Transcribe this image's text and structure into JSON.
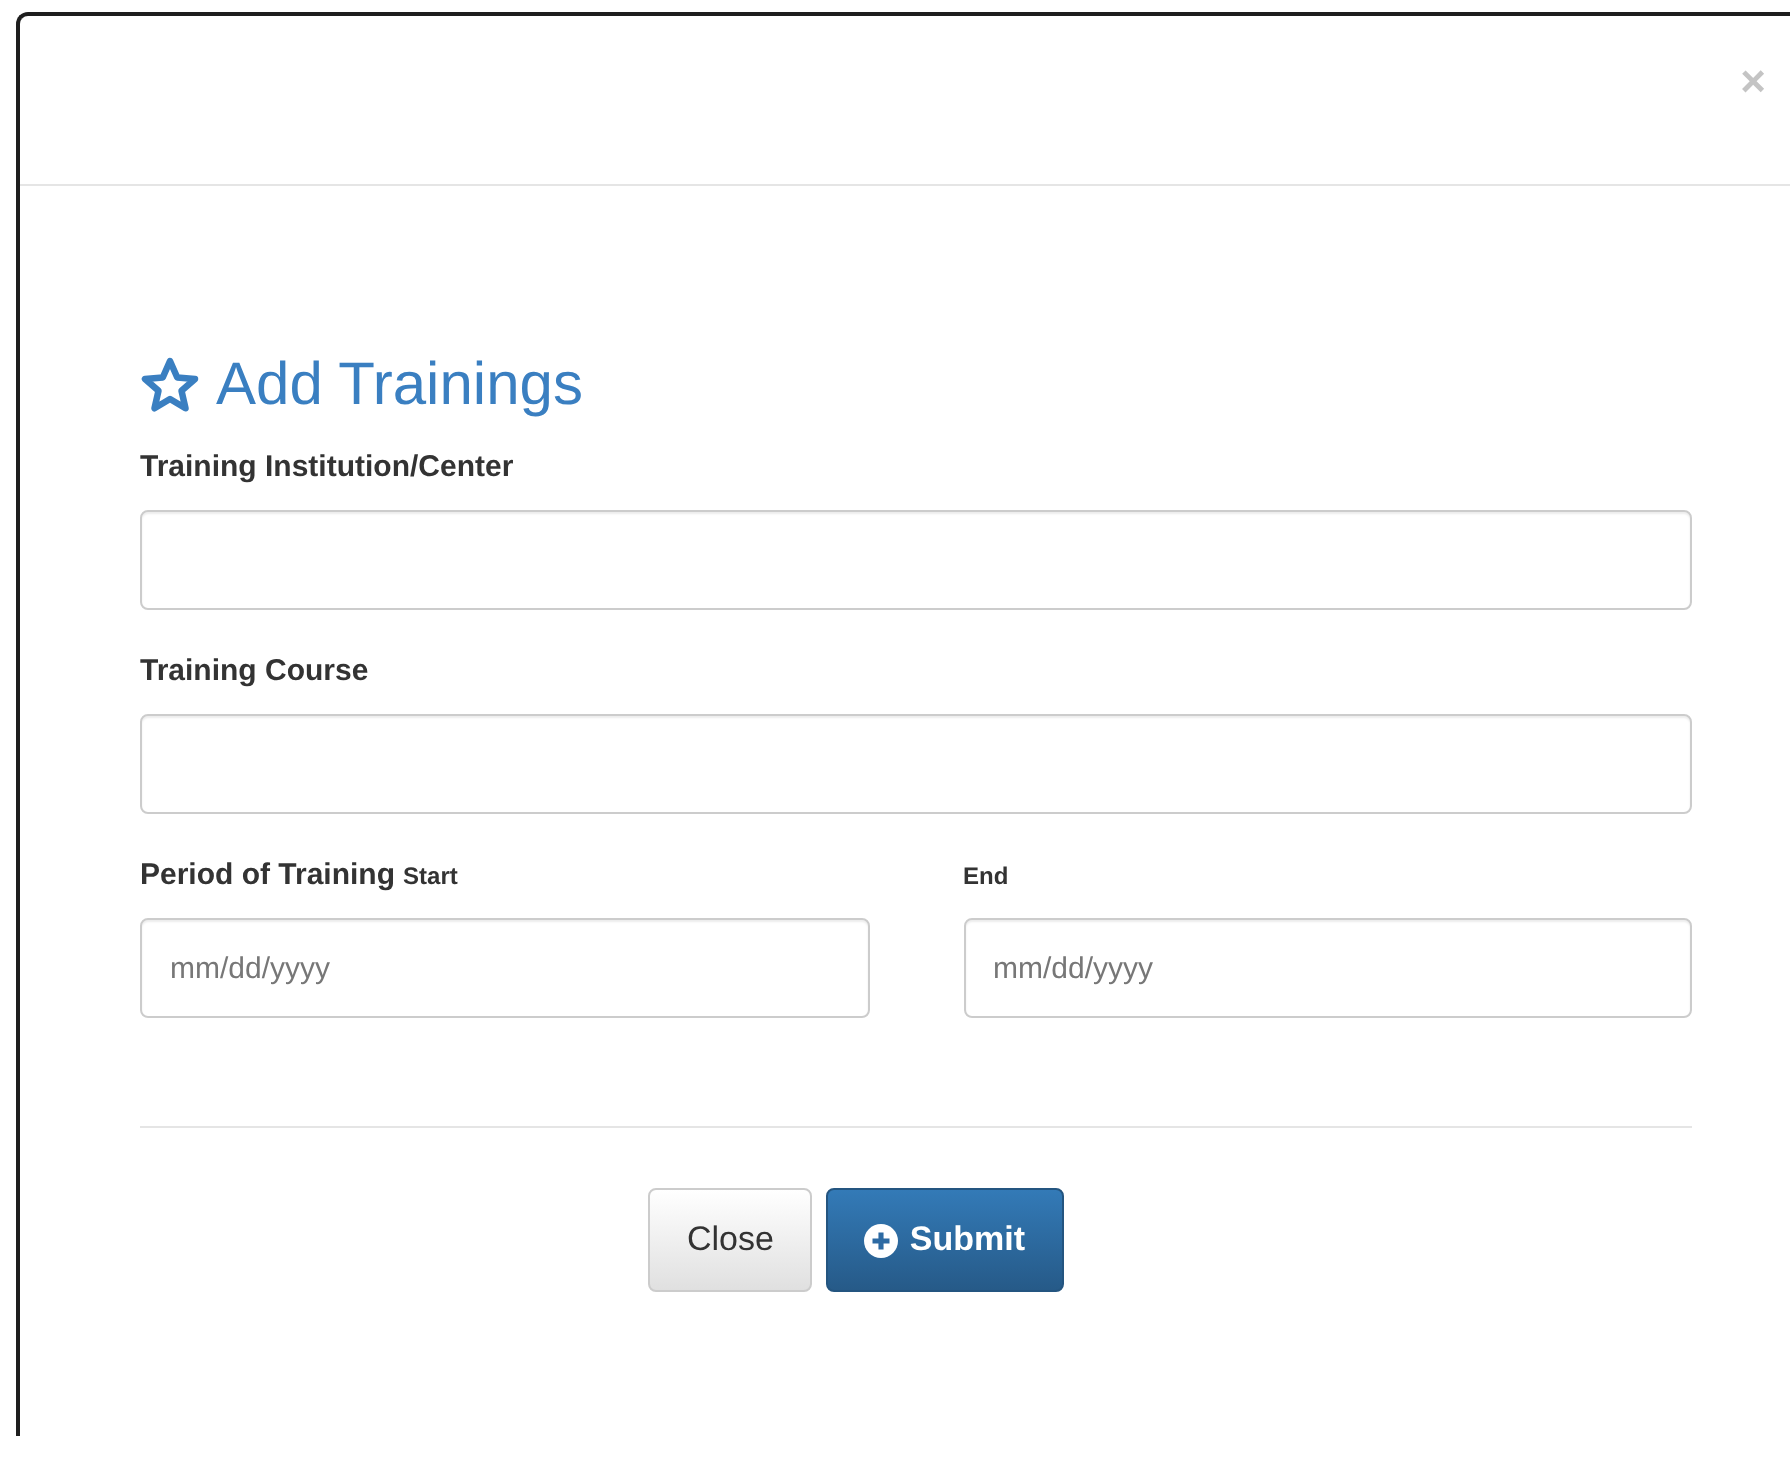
{
  "dialog": {
    "close": "×",
    "title": "Add Trainings",
    "fields": [
      {
        "label": "Training Institution/Center"
      },
      {
        "label": "Training Course"
      }
    ],
    "period": {
      "label": "Period of Training",
      "start": {
        "label": "Start",
        "placeholder": "mm/dd/yyyy"
      },
      "end": {
        "label": "End",
        "placeholder": "mm/dd/yyyy"
      }
    },
    "buttons": [
      {
        "label": "Close",
        "kind": "default"
      },
      {
        "label": "Submit",
        "kind": "primary"
      }
    ]
  }
}
